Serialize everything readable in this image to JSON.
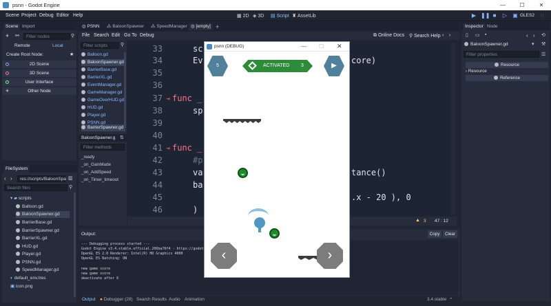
{
  "window": {
    "title": "psnn - Godot Engine",
    "controls": [
      "—",
      "☐",
      "✕"
    ]
  },
  "menubar": {
    "items": [
      "Scene",
      "Project",
      "Debug",
      "Editor",
      "Help"
    ],
    "modes": [
      "2D",
      "3D",
      "Script",
      "AssetLib"
    ],
    "renderer": "GLES2"
  },
  "scene_dock": {
    "tabs": [
      "Scene",
      "Import"
    ],
    "filter_placeholder": "Filter nodes",
    "remote": "Remote",
    "local": "Local",
    "create_root": "Create Root Node:",
    "buttons": [
      "2D Scene",
      "3D Scene",
      "User Interface",
      "Other Node"
    ]
  },
  "filesystem": {
    "tab": "FileSystem",
    "path": "res://scripts/BaloonSpa",
    "search_placeholder": "Search files",
    "folder": "scripts",
    "files": [
      "Balloon.gd",
      "BaloonSpawner.gd",
      "BarrierBase.gd",
      "BarrierSpawner.gd",
      "BarrierXL.gd",
      "HUD.gd",
      "Player.gd",
      "PSNN.gd",
      "SpeedManager.gd"
    ],
    "root_files": [
      "default_env.tres",
      "icon.png"
    ]
  },
  "script_tabs": [
    "PSNN",
    "BaloonSpawner",
    "SpeedManager",
    "[empty]"
  ],
  "script_menu": [
    "File",
    "Search",
    "Edit",
    "Go To",
    "Debug"
  ],
  "script_menu_right": [
    "Online Docs",
    "Search Help"
  ],
  "script_list": {
    "filter_placeholder": "Filter scripts",
    "items": [
      "Balloon.gd",
      "BaloonSpawner.gd",
      "BarrierBase.gd",
      "BarrierXL.gd",
      "EventManager.gd",
      "GameManager.gd",
      "GameOverHUD.gd",
      "HUD.gd",
      "Player.gd",
      "PSNN.gd",
      "BarrierSpawner.gd"
    ],
    "current": "BaloonSpawner.g",
    "methods_placeholder": "Filter methods",
    "methods": [
      "_ready",
      "_on_GainMade",
      "_on_AddSpeed",
      "_on_Timer_timeout"
    ]
  },
  "editor": {
    "lines": [
      {
        "n": "33",
        "text": "sc"
      },
      {
        "n": "34",
        "text": "Ev",
        "tail": "core)"
      },
      {
        "n": "35",
        "text": ""
      },
      {
        "n": "36",
        "text": ""
      },
      {
        "n": "37",
        "text": "func _"
      },
      {
        "n": "38",
        "text": "sp"
      },
      {
        "n": "39",
        "text": ""
      },
      {
        "n": "40",
        "text": ""
      },
      {
        "n": "41",
        "text": "func _"
      },
      {
        "n": "42",
        "text": "#p"
      },
      {
        "n": "43",
        "text": "va",
        "tail": "tance()"
      },
      {
        "n": "44",
        "text": "ba"
      },
      {
        "n": "45",
        "text": "",
        "tail": ".x - 20 ), 0"
      },
      {
        "n": "46",
        "text": ")"
      }
    ],
    "warnings": "3",
    "position": "47 :  12"
  },
  "output": {
    "label": "Output:",
    "copy": "Copy",
    "clear": "Clear",
    "lines": [
      "--- Debugging process started ---",
      "Godot Engine v3.4.stable.official.206ba70f4 - https://godotengine.org",
      "OpenGL ES 2.0 Renderer: Intel(R) HD Graphics 4000",
      "OpenGL ES Batching: ON",
      "",
      "new game score",
      "new game score",
      "deactivate after 6"
    ],
    "bottom_tabs": [
      "Output",
      "Debugger (28)",
      "Search Results",
      "Audio",
      "Animation"
    ],
    "version": "3.4.stable"
  },
  "inspector": {
    "tabs": [
      "Inspector",
      "Node"
    ],
    "object": "BaloonSpawner.gd",
    "filter_placeholder": "Filter properties",
    "resource_header": "Resource",
    "resource_row": "Resource",
    "reference": "Reference"
  },
  "game": {
    "title": "psnn (DEBUG)",
    "counter": "5",
    "activated": "ACTIVATED",
    "activated_count": "3"
  }
}
